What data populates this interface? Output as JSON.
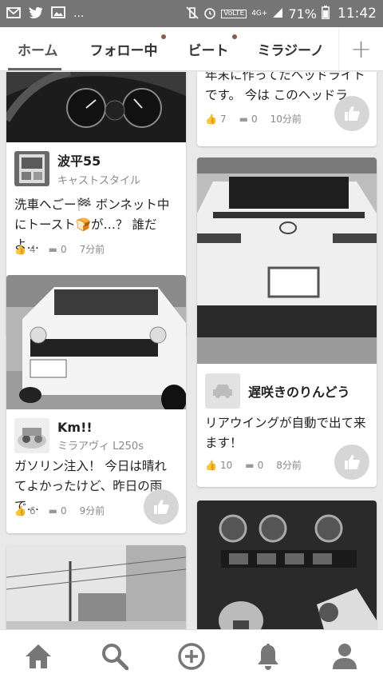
{
  "status_bar": {
    "left_icons": [
      "mail-icon",
      "twitter-icon",
      "image-icon"
    ],
    "ellipsis": "...",
    "network": "4G+",
    "battery": "71%",
    "time": "11:42"
  },
  "tabs": [
    {
      "label": "ホーム",
      "active": true,
      "dot": false
    },
    {
      "label": "フォロー中",
      "active": false,
      "dot": true
    },
    {
      "label": "ビート",
      "active": false,
      "dot": true
    },
    {
      "label": "ミラジーノ",
      "active": false,
      "dot": false
    }
  ],
  "tab_add_label": "+",
  "posts": [
    {
      "author": "波平55",
      "car": "キャストスタイル",
      "text": "洗車へごー🏁 ボンネット中にトースト🍞が…？ 誰だよ…",
      "likes": "4",
      "comments": "0",
      "time": "7分前"
    },
    {
      "author": "Km!!",
      "car": "ミラアヴィ L250s",
      "text": "ガソリン注入！ 今日は晴れてよかったけど、昨日の雨で…",
      "likes": "6",
      "comments": "0",
      "time": "9分前"
    },
    {
      "author": "",
      "car": "",
      "text": "年末に作ってたヘッドライトです。 今は このヘッドラ…",
      "likes": "7",
      "comments": "0",
      "time": "10分前"
    },
    {
      "author": "遅咲きのりんどう",
      "car": "",
      "text": "リアウイングが自動で出て来ます！",
      "likes": "10",
      "comments": "0",
      "time": "8分前"
    }
  ],
  "colors": {
    "status_bar": "#757575",
    "accent_gray": "#666666",
    "like_circle": "#d6d6d6",
    "icon_gray": "#777777"
  },
  "bottom_nav": [
    "home-icon",
    "search-icon",
    "add-post-icon",
    "notification-bell-icon",
    "profile-icon"
  ]
}
